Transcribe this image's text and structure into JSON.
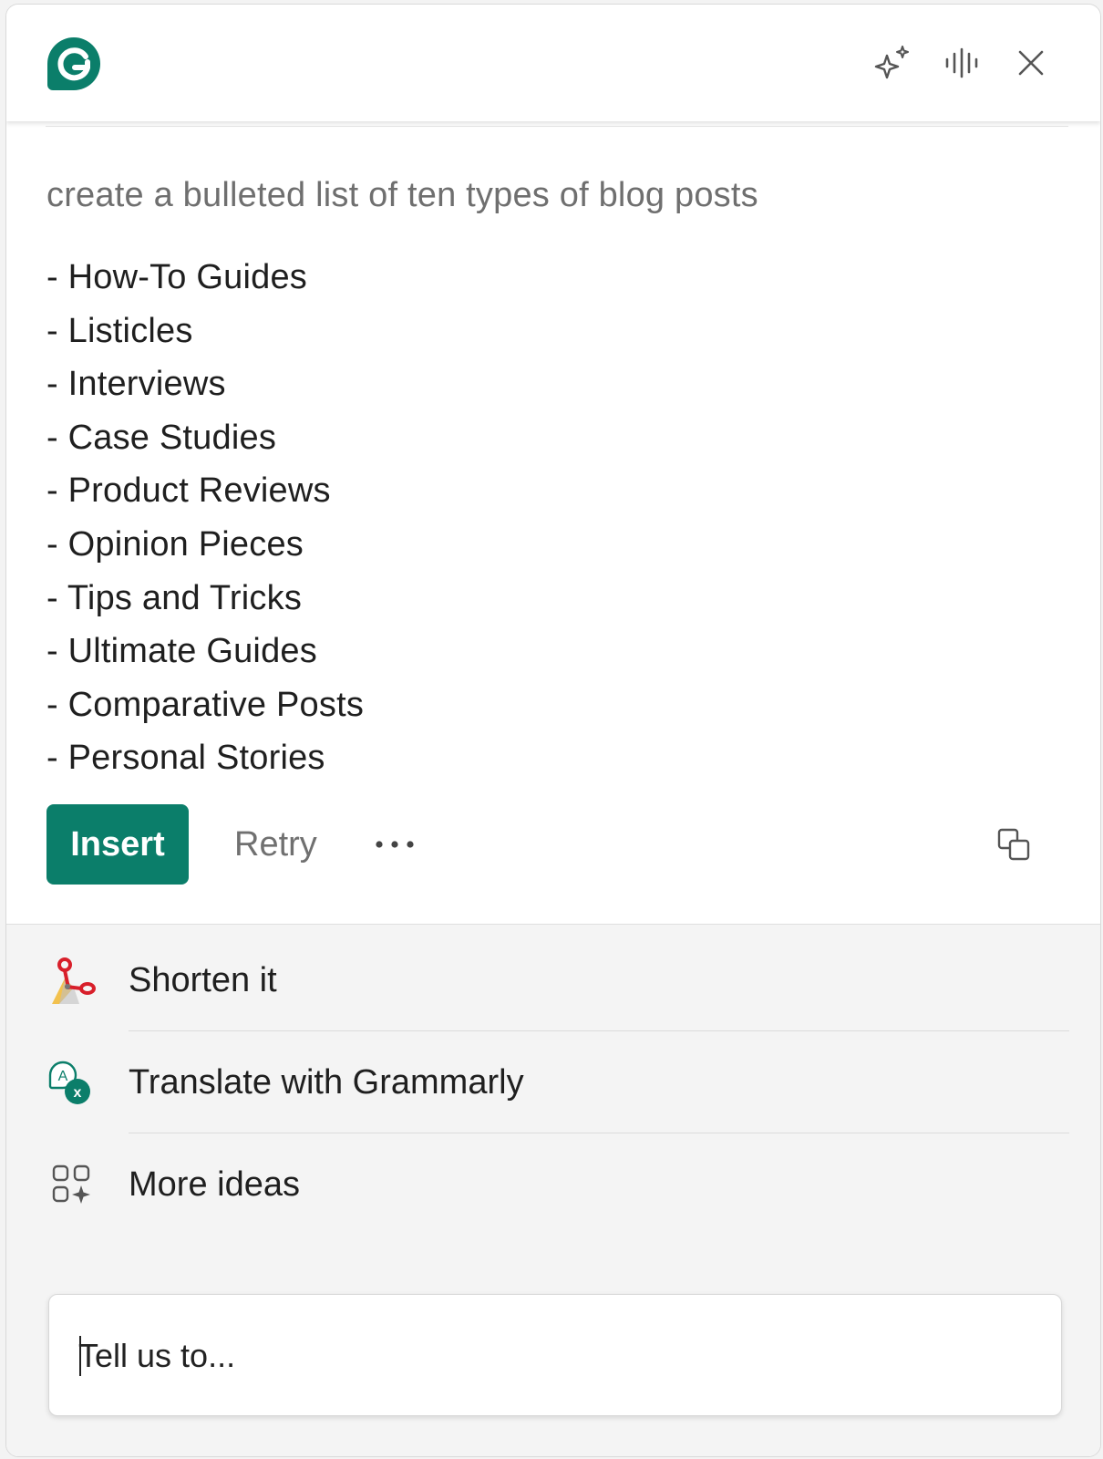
{
  "header": {
    "logo_icon": "grammarly-logo-icon",
    "actions": [
      {
        "icon": "sparkle-icon"
      },
      {
        "icon": "voice-waveform-icon"
      },
      {
        "icon": "close-icon"
      }
    ]
  },
  "prompt": {
    "text": "create a bulleted list of ten types of blog posts"
  },
  "result": {
    "items": [
      "- How-To Guides",
      "- Listicles",
      "- Interviews",
      "- Case Studies",
      "- Product Reviews",
      "- Opinion Pieces",
      "- Tips and Tricks",
      "- Ultimate Guides",
      "- Comparative Posts",
      "- Personal Stories"
    ]
  },
  "actions": {
    "insert_label": "Insert",
    "retry_label": "Retry",
    "more_icon": "ellipsis-icon",
    "copy_icon": "copy-icon"
  },
  "suggestions": [
    {
      "label": "Shorten it",
      "icon": "scissors-icon"
    },
    {
      "label": "Translate with Grammarly",
      "icon": "translate-icon"
    },
    {
      "label": "More ideas",
      "icon": "grid-sparkle-icon"
    }
  ],
  "input": {
    "placeholder": "Tell us to...",
    "value": ""
  },
  "colors": {
    "brand": "#0b7e6a",
    "scissors_red": "#d81f2a",
    "scissors_yellow": "#f2c14e"
  }
}
